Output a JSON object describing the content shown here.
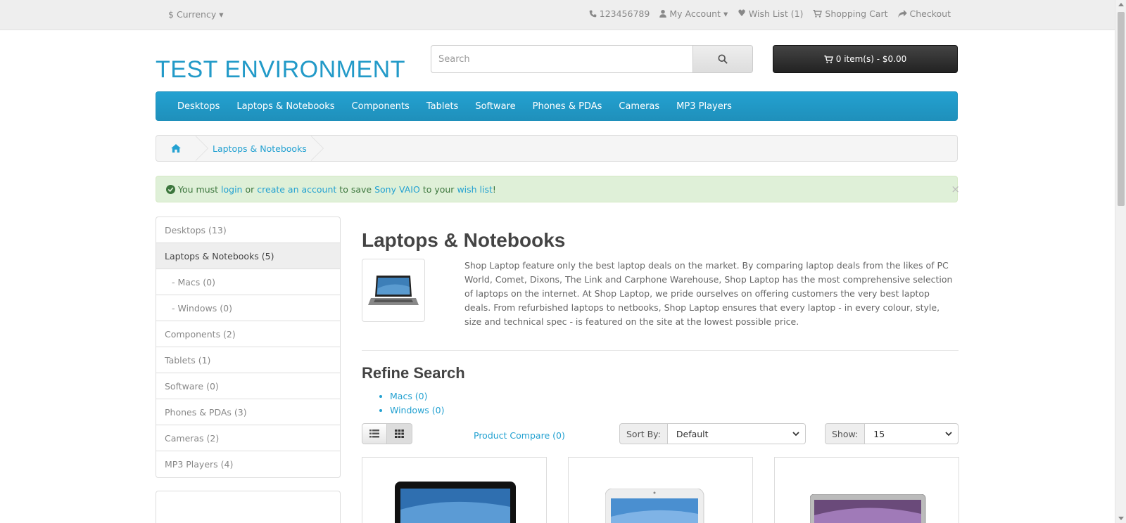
{
  "topbar": {
    "currency_symbol": "$",
    "currency_label": "Currency",
    "phone": "123456789",
    "my_account": "My Account",
    "wish_list": "Wish List (1)",
    "shopping_cart": "Shopping Cart",
    "checkout": "Checkout"
  },
  "header": {
    "logo": "TEST ENVIRONMENT",
    "search_placeholder": "Search",
    "cart_label": "0 item(s) - $0.00"
  },
  "menu": [
    "Desktops",
    "Laptops & Notebooks",
    "Components",
    "Tablets",
    "Software",
    "Phones & PDAs",
    "Cameras",
    "MP3 Players"
  ],
  "breadcrumb": {
    "current": "Laptops & Notebooks"
  },
  "alert": {
    "pre": "You must",
    "login": "login",
    "or": "or",
    "create": "create an account",
    "to_save": "to save",
    "product": "Sony VAIO",
    "to_your": "to your",
    "wishlist": "wish list",
    "end": "!",
    "close": "×"
  },
  "sidebar": [
    {
      "label": "Desktops (13)",
      "active": false,
      "sub": false
    },
    {
      "label": "Laptops & Notebooks (5)",
      "active": true,
      "sub": false
    },
    {
      "label": "- Macs (0)",
      "active": false,
      "sub": true
    },
    {
      "label": "- Windows (0)",
      "active": false,
      "sub": true
    },
    {
      "label": "Components (2)",
      "active": false,
      "sub": false
    },
    {
      "label": "Tablets (1)",
      "active": false,
      "sub": false
    },
    {
      "label": "Software (0)",
      "active": false,
      "sub": false
    },
    {
      "label": "Phones & PDAs (3)",
      "active": false,
      "sub": false
    },
    {
      "label": "Cameras (2)",
      "active": false,
      "sub": false
    },
    {
      "label": "MP3 Players (4)",
      "active": false,
      "sub": false
    }
  ],
  "content": {
    "title": "Laptops & Notebooks",
    "description": "Shop Laptop feature only the best laptop deals on the market. By comparing laptop deals from the likes of PC World, Comet, Dixons, The Link and Carphone Warehouse, Shop Laptop has the most comprehensive selection of laptops on the internet. At Shop Laptop, we pride ourselves on offering customers the very best laptop deals. From refurbished laptops to netbooks, Shop Laptop ensures that every laptop - in every colour, style, size and technical spec - is featured on the site at the lowest possible price.",
    "refine_title": "Refine Search",
    "refine": [
      "Macs (0)",
      "Windows (0)"
    ],
    "compare": "Product Compare (0)",
    "sort_label": "Sort By:",
    "sort_value": "Default",
    "show_label": "Show:",
    "show_value": "15"
  },
  "colors": {
    "brand": "#229ac8",
    "menu": "#23a1d1",
    "alert_bg": "#dff0d8",
    "cart_btn": "#303030"
  }
}
